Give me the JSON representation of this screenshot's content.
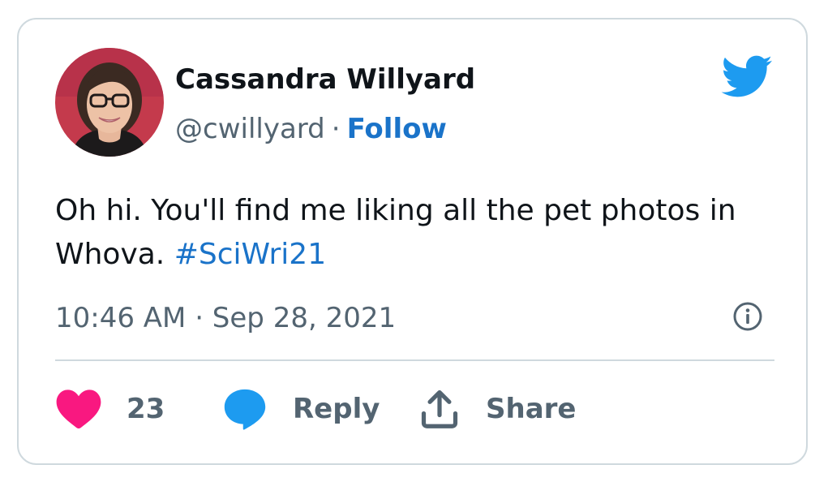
{
  "tweet": {
    "author": {
      "name": "Cassandra Willyard",
      "handle": "@cwillyard",
      "separator": "·",
      "follow_label": "Follow"
    },
    "text": "Oh hi. You'll find me liking all the pet photos in Whova.",
    "hashtag": "#SciWri21",
    "timestamp": "10:46 AM · Sep 28, 2021",
    "actions": {
      "like_count": "23",
      "reply_label": "Reply",
      "share_label": "Share"
    }
  },
  "icons": {
    "brand": "twitter-bird-icon",
    "info": "info-icon",
    "like": "heart-icon",
    "reply": "speech-bubble-icon",
    "share": "share-upload-icon"
  },
  "colors": {
    "brand_blue": "#1d9bf0",
    "link_blue": "#1a73c9",
    "like_pink": "#f91880",
    "text_primary": "#0f1419",
    "text_secondary": "#536471",
    "border": "#cfd9de"
  }
}
